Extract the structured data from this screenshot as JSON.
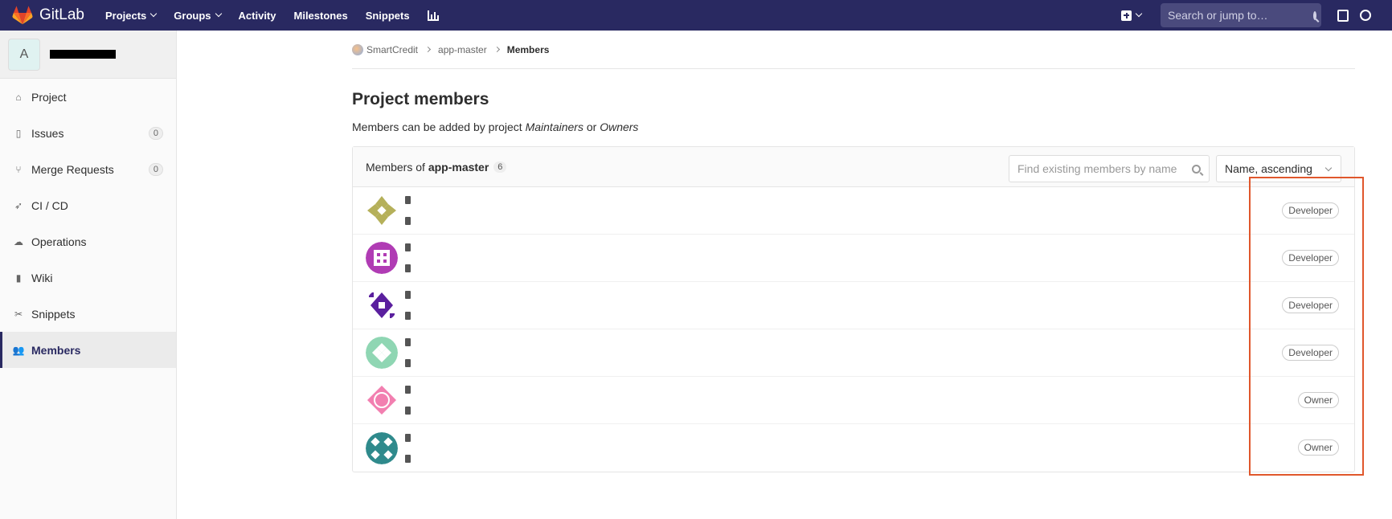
{
  "navbar": {
    "brand": "GitLab",
    "links": [
      {
        "label": "Projects",
        "dropdown": true
      },
      {
        "label": "Groups",
        "dropdown": true
      },
      {
        "label": "Activity",
        "dropdown": false
      },
      {
        "label": "Milestones",
        "dropdown": false
      },
      {
        "label": "Snippets",
        "dropdown": false
      }
    ],
    "search_placeholder": "Search or jump to…"
  },
  "sidebar": {
    "project_avatar_letter": "A",
    "items": [
      {
        "label": "Project",
        "icon": "home-icon",
        "badge": null
      },
      {
        "label": "Issues",
        "icon": "issues-icon",
        "badge": "0"
      },
      {
        "label": "Merge Requests",
        "icon": "merge-request-icon",
        "badge": "0"
      },
      {
        "label": "CI / CD",
        "icon": "rocket-icon",
        "badge": null
      },
      {
        "label": "Operations",
        "icon": "cloud-gear-icon",
        "badge": null
      },
      {
        "label": "Wiki",
        "icon": "book-icon",
        "badge": null
      },
      {
        "label": "Snippets",
        "icon": "scissors-icon",
        "badge": null
      },
      {
        "label": "Members",
        "icon": "users-icon",
        "badge": null,
        "active": true
      }
    ]
  },
  "breadcrumb": {
    "group": "SmartCredit",
    "project": "app-master",
    "current": "Members"
  },
  "page": {
    "title": "Project members",
    "subtitle_prefix": "Members can be added by project ",
    "maintainers": "Maintainers",
    "or": " or ",
    "owners": "Owners"
  },
  "panel": {
    "members_of": "Members of ",
    "project": "app-master",
    "count": "6",
    "filter_placeholder": "Find existing members by name",
    "sort_label": "Name, ascending"
  },
  "members": [
    {
      "role": "Developer",
      "avatar_color": "#b5b05a"
    },
    {
      "role": "Developer",
      "avatar_color": "#b03cb4"
    },
    {
      "role": "Developer",
      "avatar_color": "#5a1f9e"
    },
    {
      "role": "Developer",
      "avatar_color": "#8fd6b3"
    },
    {
      "role": "Owner",
      "avatar_color": "#f27fb0"
    },
    {
      "role": "Owner",
      "avatar_color": "#2f8a8c"
    }
  ],
  "colors": {
    "navbar": "#292961",
    "highlight": "#e0572c"
  }
}
